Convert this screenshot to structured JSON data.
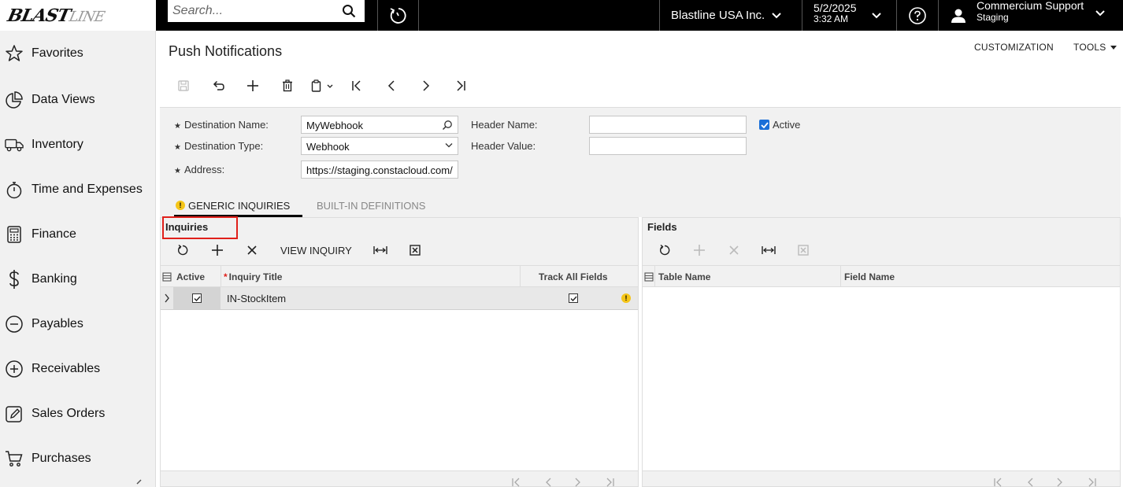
{
  "app": {
    "logo_main": "BLAST",
    "logo_tail": "LINE"
  },
  "search": {
    "placeholder": "Search..."
  },
  "topbar": {
    "company": "Blastline USA Inc.",
    "date": "5/2/2025",
    "time": "3:32 AM",
    "user_name": "Commercium Support",
    "user_role": "Staging"
  },
  "sidebar": {
    "items": [
      {
        "label": "Favorites",
        "icon": "star-icon"
      },
      {
        "label": "Data Views",
        "icon": "pie-chart-icon"
      },
      {
        "label": "Inventory",
        "icon": "truck-icon"
      },
      {
        "label": "Time and Expenses",
        "icon": "stopwatch-icon"
      },
      {
        "label": "Finance",
        "icon": "calculator-icon"
      },
      {
        "label": "Banking",
        "icon": "dollar-icon"
      },
      {
        "label": "Payables",
        "icon": "minus-circle-icon"
      },
      {
        "label": "Receivables",
        "icon": "plus-circle-icon"
      },
      {
        "label": "Sales Orders",
        "icon": "edit-icon"
      },
      {
        "label": "Purchases",
        "icon": "cart-icon"
      }
    ]
  },
  "page": {
    "title": "Push Notifications",
    "customization": "CUSTOMIZATION",
    "tools": "TOOLS"
  },
  "form": {
    "destination_name_label": "Destination Name:",
    "destination_name_value": "MyWebhook",
    "destination_type_label": "Destination Type:",
    "destination_type_value": "Webhook",
    "address_label": "Address:",
    "address_value": "https://staging.constacloud.com/",
    "header_name_label": "Header Name:",
    "header_name_value": "",
    "header_value_label": "Header Value:",
    "header_value_value": "",
    "active_label": "Active",
    "active_checked": true
  },
  "tabs": {
    "generic_inquiries": "GENERIC INQUIRIES",
    "built_in_definitions": "BUILT-IN DEFINITIONS"
  },
  "inquiries": {
    "title": "Inquiries",
    "view_inquiry": "VIEW INQUIRY",
    "columns": {
      "active": "Active",
      "inquiry_title": "Inquiry Title",
      "track_all_fields": "Track All Fields"
    },
    "rows": [
      {
        "active": true,
        "inquiry_title": "IN-StockItem",
        "track_all_fields": true
      }
    ]
  },
  "fields": {
    "title": "Fields",
    "columns": {
      "table_name": "Table Name",
      "field_name": "Field Name"
    },
    "rows": []
  },
  "colors": {
    "accent": "#1a6fd8",
    "highlight": "#e0201b",
    "warning": "#f5c518",
    "topbar": "#000000"
  }
}
